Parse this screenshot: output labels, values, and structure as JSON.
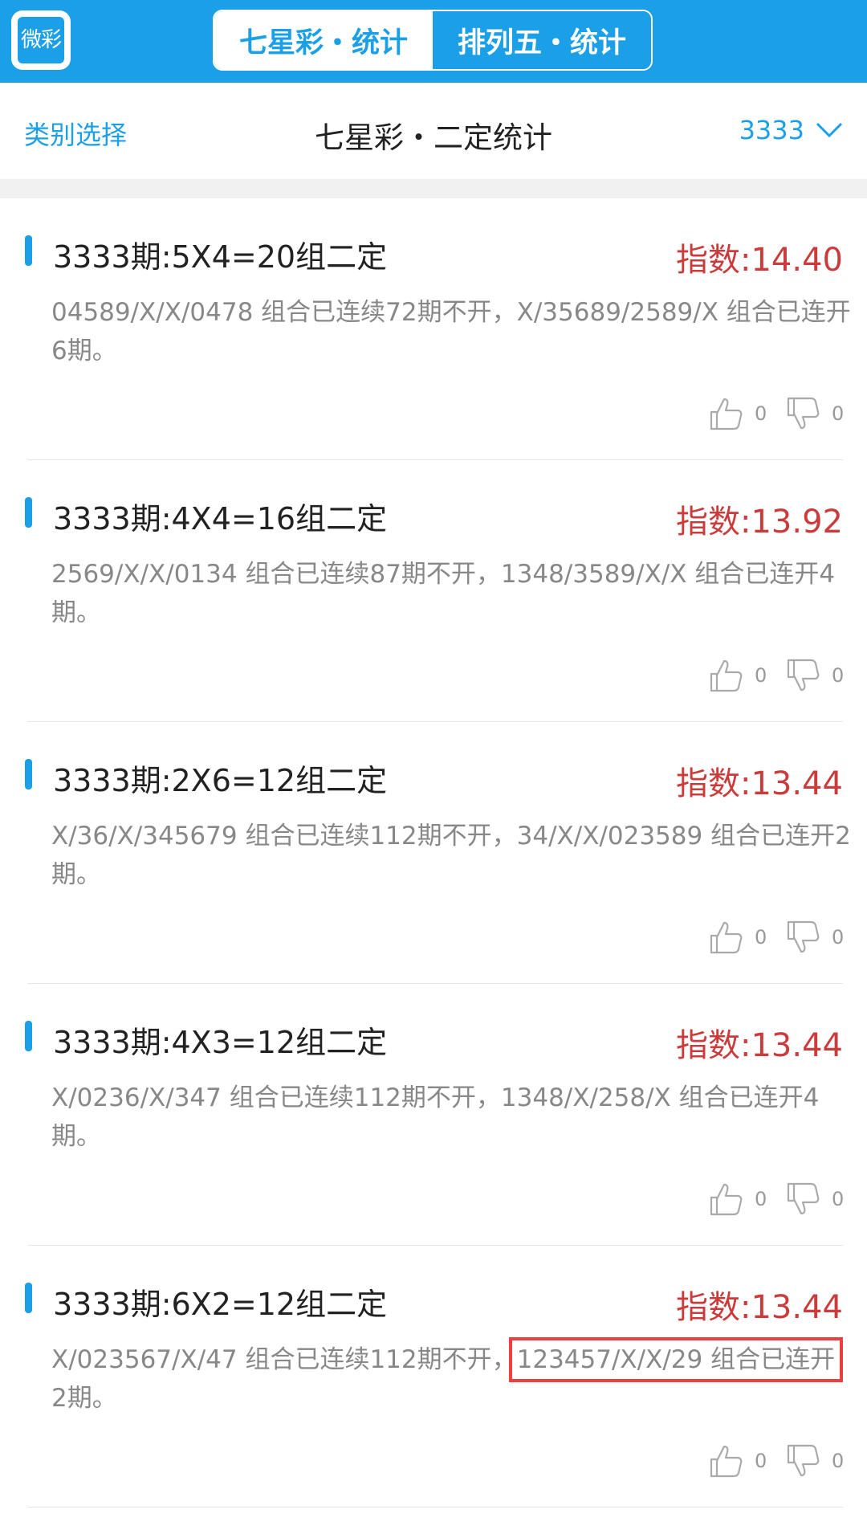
{
  "app": {
    "logo_text": "微彩",
    "tabs": [
      {
        "label": "七星彩・统计",
        "active": true
      },
      {
        "label": "排列五・统计",
        "active": false
      }
    ]
  },
  "header": {
    "category_select": "类别选择",
    "title": "七星彩・二定统计",
    "period": "3333"
  },
  "cards": [
    {
      "title": "3333期:5X4=20组二定",
      "index": "指数:14.40",
      "desc_a": "04589/X/X/0478 组合已连续72期不开，",
      "desc_b": "X/35689/2589/X 组合已连开6期。",
      "likes": "0",
      "dislikes": "0"
    },
    {
      "title": "3333期:4X4=16组二定",
      "index": "指数:13.92",
      "desc_a": "2569/X/X/0134 组合已连续87期不开，",
      "desc_b": "1348/3589/X/X 组合已连开4期。",
      "likes": "0",
      "dislikes": "0"
    },
    {
      "title": "3333期:2X6=12组二定",
      "index": "指数:13.44",
      "desc_a": "X/36/X/345679 组合已连续112期不开，",
      "desc_b": "34/X/X/023589 组合已连开2期。",
      "likes": "0",
      "dislikes": "0"
    },
    {
      "title": "3333期:4X3=12组二定",
      "index": "指数:13.44",
      "desc_a": "X/0236/X/347 组合已连续112期不开，",
      "desc_b": "1348/X/258/X 组合已连开4期。",
      "likes": "0",
      "dislikes": "0"
    },
    {
      "title": "3333期:6X2=12组二定",
      "index": "指数:13.44",
      "desc_a": "X/023567/X/47 组合已连续112期不开，",
      "desc_b": "123457/X/X/29 组合已连开",
      "desc_c": "2期。",
      "likes": "0",
      "dislikes": "0"
    }
  ],
  "colors": {
    "accent": "#1ba0e8",
    "index_red": "#cc3b3b",
    "highlight_box": "#ee3f3f"
  },
  "icons": [
    "thumbs-up-icon",
    "thumbs-down-icon",
    "chevron-down-icon"
  ]
}
